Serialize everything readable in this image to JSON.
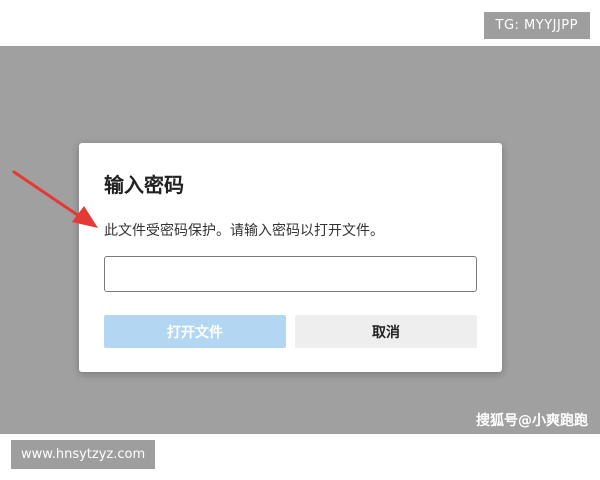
{
  "top_label": "TG: MYYJJPP",
  "dialog": {
    "title": "输入密码",
    "message": "此文件受密码保护。请输入密码以打开文件。",
    "password_value": "",
    "open_button_label": "打开文件",
    "cancel_button_label": "取消"
  },
  "watermarks": {
    "bottom_right": "搜狐号@小爽跑跑",
    "bottom_left": "www.hnsytzyz.com"
  },
  "colors": {
    "overlay": "#a0a0a0",
    "open_button_disabled": "#b3d7f2",
    "cancel_button": "#eeeeee",
    "arrow": "#e53935"
  },
  "icons": {
    "annotation": "red-arrow-icon"
  }
}
